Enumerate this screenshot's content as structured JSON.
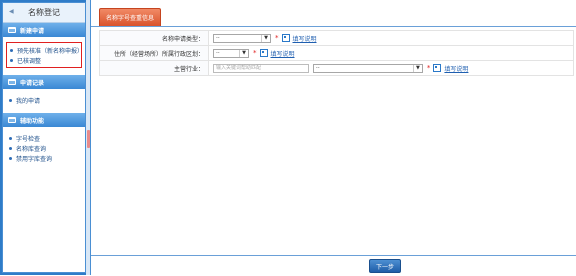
{
  "sidebar": {
    "title": "名称登记",
    "sections": [
      {
        "label": "新建申请",
        "items": [
          "预先核准（新名称申报）",
          "已核调整"
        ]
      },
      {
        "label": "申请记录",
        "items": [
          "我的申请"
        ]
      },
      {
        "label": "辅助功能",
        "items": [
          "字号检查",
          "名称库查询",
          "禁用字库查询"
        ]
      }
    ]
  },
  "main": {
    "tab_label": "名称字号查重信息",
    "form": {
      "type": {
        "label": "名称申请类型：",
        "value": "--"
      },
      "region": {
        "label": "住所（经营场所）所属行政区划：",
        "value": "--"
      },
      "industry": {
        "label": "主营行业：",
        "input_placeholder": "输入关键词帮助匹配",
        "select_value": "--"
      },
      "help_text": "填写说明",
      "required_mark": "*"
    },
    "next_button": "下一步"
  }
}
